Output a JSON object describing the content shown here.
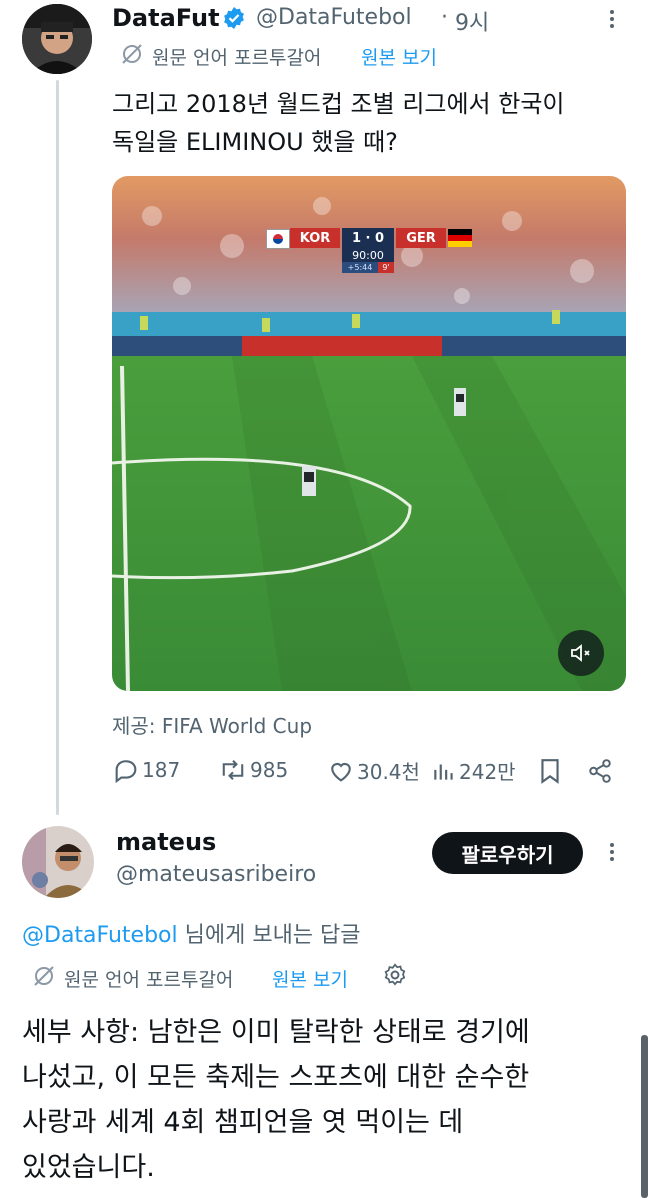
{
  "tweet": {
    "author_name": "DataFut",
    "handle": "@DataFutebol",
    "separator": "·",
    "time": "9시",
    "translate_hint": "원문 언어 포르투갈어",
    "view_original": "원본 보기",
    "text_line1": "그리고 2018년 월드컵 조별 리그에서 한국이",
    "text_line2": "독일을 ELIMINOU 했을 때?",
    "media": {
      "score_home": "KOR",
      "score": "1 · 0",
      "score_away": "GER",
      "clock": "90:00",
      "added": "+5:44",
      "minute_badge": "9'"
    },
    "source": "제공: FIFA World Cup",
    "stats": {
      "replies": "187",
      "retweets": "985",
      "likes": "30.4천",
      "views": "242만"
    }
  },
  "reply": {
    "author_name": "mateus",
    "handle": "@mateusasribeiro",
    "follow_label": "팔로우하기",
    "replying_to_handle": "@DataFutebol",
    "replying_to_suffix": " 님에게 보내는 답글",
    "translate_hint": "원문 언어 포르투갈어",
    "view_original": "원본 보기",
    "text_line1": "세부 사항: 남한은 이미 탈락한 상태로 경기에",
    "text_line2": "나섰고, 이 모든 축제는 스포츠에 대한 순수한",
    "text_line3": "사랑과 세계 4회 챔피언을 엿 먹이는 데",
    "text_line4": "있었습니다."
  },
  "colors": {
    "accent": "#1d9bf0",
    "text": "#0f1419",
    "muted": "#536471",
    "pitch": "#3f9b3e"
  }
}
